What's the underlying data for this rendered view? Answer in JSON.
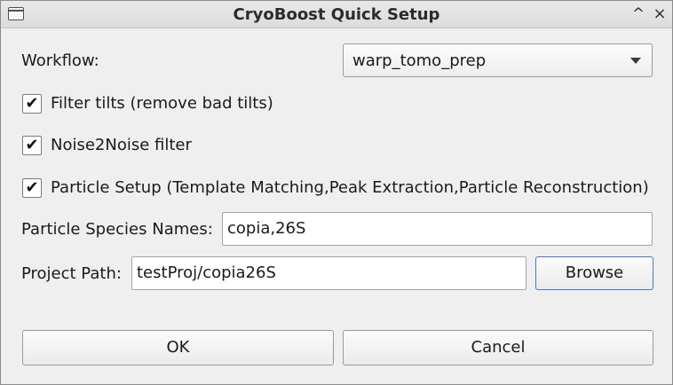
{
  "window": {
    "title": "CryoBoost Quick Setup",
    "maximize_glyph": "^",
    "close_glyph": "×"
  },
  "workflow": {
    "label": "Workflow:",
    "selected": "warp_tomo_prep"
  },
  "options": [
    {
      "label": "Filter tilts (remove bad tilts)",
      "checked": true,
      "mark": "✔"
    },
    {
      "label": "Noise2Noise filter",
      "checked": true,
      "mark": "✔"
    },
    {
      "label": "Particle Setup (Template Matching,Peak Extraction,Particle Reconstruction)",
      "checked": true,
      "mark": "✔"
    }
  ],
  "species": {
    "label": "Particle Species Names:",
    "value": "copia,26S"
  },
  "project": {
    "label": "Project Path:",
    "value": "testProj/copia26S",
    "browse_label": "Browse"
  },
  "buttons": {
    "ok": "OK",
    "cancel": "Cancel"
  },
  "colors": {
    "window_bg": "#efefef",
    "focus_border": "#4a78b8"
  }
}
